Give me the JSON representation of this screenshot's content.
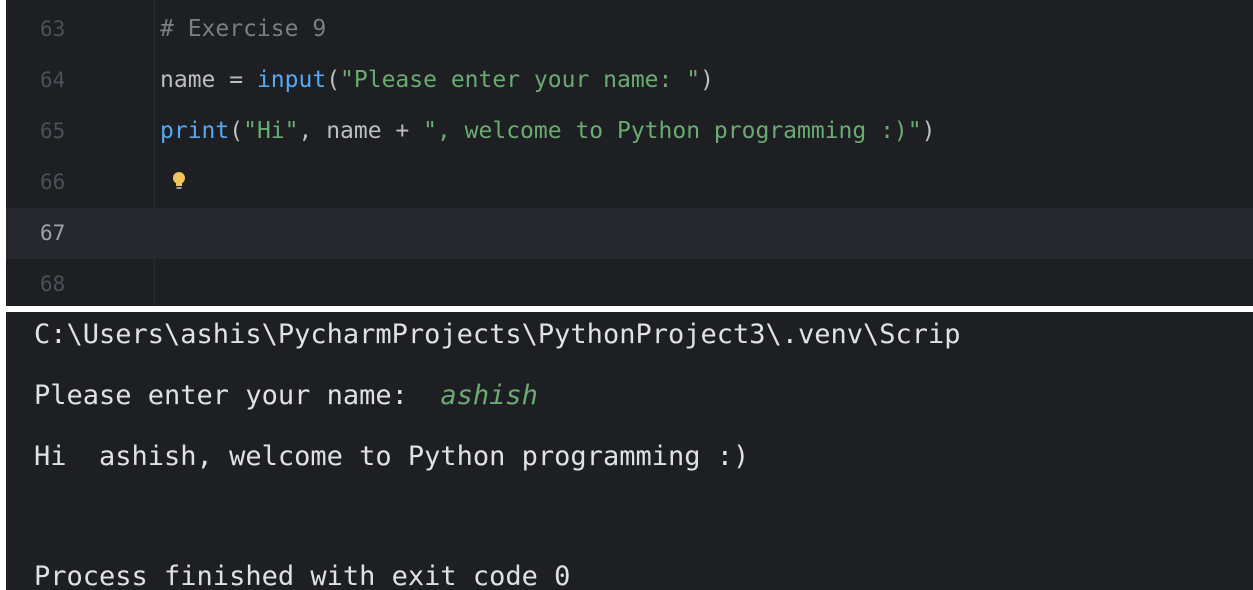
{
  "editor": {
    "lines": [
      {
        "number": "63",
        "tokens": {
          "t1": "# Exercise 9"
        }
      },
      {
        "number": "64",
        "tokens": {
          "t1": "name = ",
          "t2": "input",
          "t3": "(",
          "t4": "\"Please enter your name: \"",
          "t5": ")"
        }
      },
      {
        "number": "65",
        "tokens": {
          "t1": "print",
          "t2": "(",
          "t3": "\"Hi\"",
          "t4": ", name + ",
          "t5": "\", welcome to Python programming :)\"",
          "t6": ")"
        }
      },
      {
        "number": "66"
      },
      {
        "number": "67"
      },
      {
        "number": "68"
      }
    ],
    "intention_icon": "lightbulb-icon",
    "colors": {
      "background": "#1e1f22",
      "current_line": "#26282e",
      "comment": "#7a7e85",
      "function": "#56a8f5",
      "string": "#6aab73"
    }
  },
  "console": {
    "command": "C:\\Users\\ashis\\PycharmProjects\\PythonProject3\\.venv\\Scrip",
    "prompt": "Please enter your name:  ",
    "user_input": "ashish",
    "greeting": "Hi  ashish, welcome to Python programming :)",
    "exit_message": "Process finished with exit code 0"
  }
}
